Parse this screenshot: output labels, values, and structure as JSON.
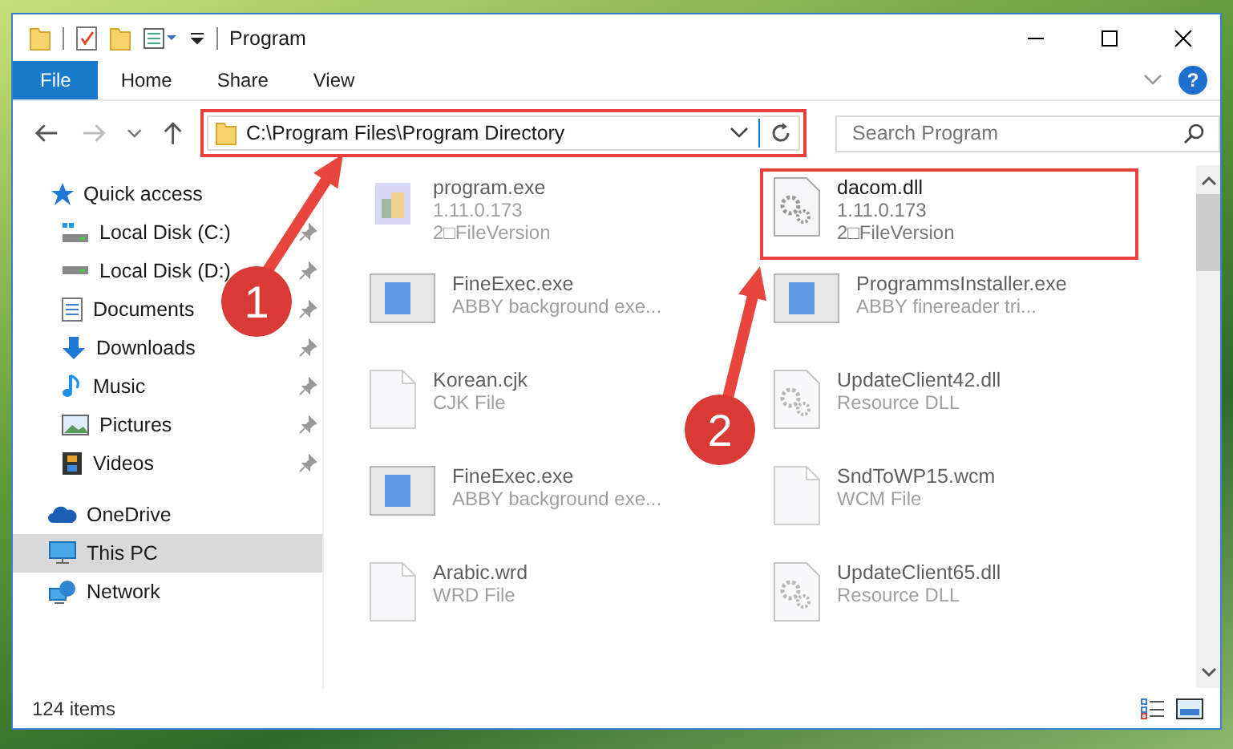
{
  "window": {
    "title": "Program"
  },
  "ribbon_tabs": [
    {
      "label": "File",
      "selected": true
    },
    {
      "label": "Home",
      "selected": false
    },
    {
      "label": "Share",
      "selected": false
    },
    {
      "label": "View",
      "selected": false
    }
  ],
  "address": {
    "path": "C:\\Program Files\\Program Directory",
    "highlighted": true
  },
  "search": {
    "placeholder": "Search Program"
  },
  "help": {
    "label": "?"
  },
  "sidebar": {
    "items": [
      {
        "label": "Quick access",
        "kind": "star",
        "selected": false,
        "children": [
          {
            "label": "Local Disk (C:)",
            "kind": "system-disk",
            "selected": false,
            "pinned": true
          },
          {
            "label": "Local Disk (D:)",
            "kind": "disk",
            "selected": false,
            "pinned": true
          },
          {
            "label": "Documents",
            "kind": "documents",
            "selected": false,
            "pinned": true
          },
          {
            "label": "Downloads",
            "kind": "downloads",
            "selected": false,
            "pinned": true
          },
          {
            "label": "Music",
            "kind": "music",
            "selected": false,
            "pinned": true
          },
          {
            "label": "Pictures",
            "kind": "pictures",
            "selected": false,
            "pinned": true
          },
          {
            "label": "Videos",
            "kind": "videos",
            "selected": false,
            "pinned": true
          }
        ]
      },
      {
        "label": "OneDrive",
        "kind": "cloud",
        "selected": false
      },
      {
        "label": "This PC",
        "kind": "pc",
        "selected": true
      },
      {
        "label": "Network",
        "kind": "network",
        "selected": false
      }
    ]
  },
  "files": [
    {
      "name": "program.exe",
      "details": [
        "1.11.0.173",
        "2□FileVersion"
      ],
      "kind": "installer",
      "blurred": true,
      "highlighted": false
    },
    {
      "name": "dacom.dll",
      "details": [
        "1.11.0.173",
        "2□FileVersion"
      ],
      "kind": "dll",
      "blurred": false,
      "highlighted": true
    },
    {
      "name": "FineExec.exe",
      "details": [
        "ABBY background exe..."
      ],
      "kind": "window",
      "blurred": true,
      "highlighted": false
    },
    {
      "name": "ProgrammsInstaller.exe",
      "details": [
        "ABBY finereader tri..."
      ],
      "kind": "window",
      "blurred": true,
      "highlighted": false
    },
    {
      "name": "Korean.cjk",
      "details": [
        "CJK File"
      ],
      "kind": "blank",
      "blurred": true,
      "highlighted": false
    },
    {
      "name": "UpdateClient42.dll",
      "details": [
        "Resource DLL"
      ],
      "kind": "dll",
      "blurred": true,
      "highlighted": false
    },
    {
      "name": "FineExec.exe",
      "details": [
        "ABBY background exe..."
      ],
      "kind": "window",
      "blurred": true,
      "highlighted": false
    },
    {
      "name": "SndToWP15.wcm",
      "details": [
        "WCM File"
      ],
      "kind": "blank",
      "blurred": true,
      "highlighted": false
    },
    {
      "name": "Arabic.wrd",
      "details": [
        "WRD File"
      ],
      "kind": "blank",
      "blurred": true,
      "highlighted": false
    },
    {
      "name": "UpdateClient65.dll",
      "details": [
        "Resource DLL"
      ],
      "kind": "dll",
      "blurred": true,
      "highlighted": false
    }
  ],
  "status_bar": {
    "item_count": "124 items"
  },
  "annotations": [
    {
      "label": "1"
    },
    {
      "label": "2"
    }
  ]
}
